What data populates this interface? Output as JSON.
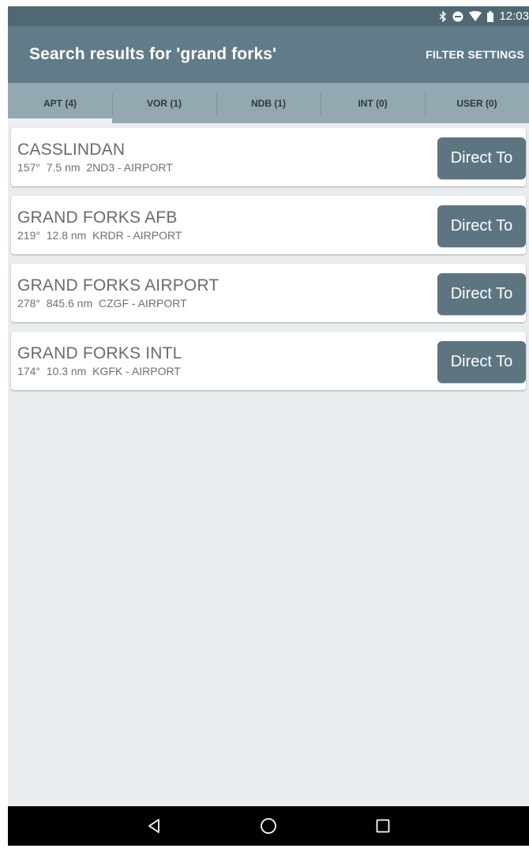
{
  "status_bar": {
    "time": "12:03",
    "icons": [
      "bluetooth-icon",
      "do-not-disturb-icon",
      "wifi-icon",
      "battery-icon"
    ]
  },
  "app_bar": {
    "title": "Search results for 'grand forks'",
    "filter_label": "FILTER SETTINGS"
  },
  "tabs": [
    {
      "label": "APT (4)",
      "active": true
    },
    {
      "label": "VOR (1)",
      "active": false
    },
    {
      "label": "NDB (1)",
      "active": false
    },
    {
      "label": "INT (0)",
      "active": false
    },
    {
      "label": "USER (0)",
      "active": false
    }
  ],
  "results": [
    {
      "name": "CASSLINDAN",
      "detail": "157°  7.5 nm  2ND3 - AIRPORT",
      "button": "Direct To"
    },
    {
      "name": "GRAND FORKS AFB",
      "detail": "219°  12.8 nm  KRDR - AIRPORT",
      "button": "Direct To"
    },
    {
      "name": "GRAND FORKS AIRPORT",
      "detail": "278°  845.6 nm  CZGF - AIRPORT",
      "button": "Direct To"
    },
    {
      "name": "GRAND FORKS INTL",
      "detail": "174°  10.3 nm  KGFK - AIRPORT",
      "button": "Direct To"
    }
  ],
  "nav_bar": {
    "icons": [
      "back-icon",
      "home-icon",
      "recents-icon"
    ]
  },
  "colors": {
    "status_bar": "#4f6872",
    "app_bar": "#617c88",
    "tabs": "#93a8b1",
    "button": "#5d7580",
    "background": "#eaedef"
  }
}
